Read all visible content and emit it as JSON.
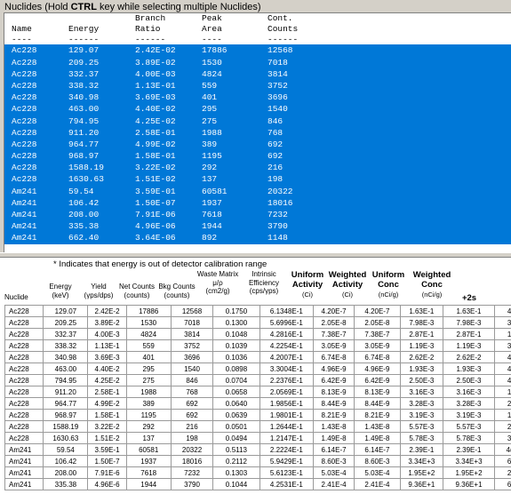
{
  "top": {
    "caption_prefix": "Nuclides  (Hold ",
    "caption_key": "CTRL",
    "caption_suffix": " key while selecting multiple Nuclides)",
    "header_line1": [
      "",
      "",
      "Branch",
      "Peak",
      "Cont."
    ],
    "header_line2": [
      "Name",
      "Energy",
      "Ratio",
      "Area",
      "Counts"
    ],
    "separator": [
      "----",
      "------",
      "------",
      "----",
      "------"
    ],
    "rows": [
      [
        "Ac228",
        "129.07",
        "2.42E-02",
        "17886",
        "12568"
      ],
      [
        "Ac228",
        "209.25",
        "3.89E-02",
        "1530",
        "7018"
      ],
      [
        "Ac228",
        "332.37",
        "4.00E-03",
        "4824",
        "3814"
      ],
      [
        "Ac228",
        "338.32",
        "1.13E-01",
        "559",
        "3752"
      ],
      [
        "Ac228",
        "340.98",
        "3.69E-03",
        "401",
        "3696"
      ],
      [
        "Ac228",
        "463.00",
        "4.40E-02",
        "295",
        "1540"
      ],
      [
        "Ac228",
        "794.95",
        "4.25E-02",
        "275",
        "846"
      ],
      [
        "Ac228",
        "911.20",
        "2.58E-01",
        "1988",
        "768"
      ],
      [
        "Ac228",
        "964.77",
        "4.99E-02",
        "389",
        "692"
      ],
      [
        "Ac228",
        "968.97",
        "1.58E-01",
        "1195",
        "692"
      ],
      [
        "Ac228",
        "1588.19",
        "3.22E-02",
        "292",
        "216"
      ],
      [
        "Ac228",
        "1630.63",
        "1.51E-02",
        "137",
        "198"
      ],
      [
        "Am241",
        "59.54",
        "3.59E-01",
        "60581",
        "20322"
      ],
      [
        "Am241",
        "106.42",
        "1.50E-07",
        "1937",
        "18016"
      ],
      [
        "Am241",
        "208.00",
        "7.91E-06",
        "7618",
        "7232"
      ],
      [
        "Am241",
        "335.38",
        "4.96E-06",
        "1944",
        "3790"
      ],
      [
        "Am241",
        "662.40",
        "3.64E-06",
        "892",
        "1148"
      ]
    ]
  },
  "bottom": {
    "note": "* Indicates that energy is out of detector calibration range",
    "headers": [
      {
        "label": "Nuclide",
        "unit": ""
      },
      {
        "label": "Energy",
        "unit": "(keV)"
      },
      {
        "label": "Yield",
        "unit": "(γps/dps)"
      },
      {
        "label": "Net Counts",
        "unit": "(counts)"
      },
      {
        "label": "Bkg Counts",
        "unit": "(counts)"
      },
      {
        "label": "Waste Matrix",
        "unit": "μ/ρ",
        "unit2": "(cm2/g)"
      },
      {
        "label": "Intrinsic",
        "unit": "Efficiency",
        "unit2": "(cps/γps)"
      },
      {
        "label": "Uniform",
        "label2": "Activity",
        "unit": "(Ci)"
      },
      {
        "label": "Weighted",
        "label2": "Activity",
        "unit": "(Ci)"
      },
      {
        "label": "Uniform",
        "label2": "Conc",
        "unit": "(nCi/g)"
      },
      {
        "label": "Weighted",
        "label2": "Conc",
        "unit": "(nCi/g)"
      },
      {
        "label": "+2s",
        "unit": ""
      }
    ],
    "rows": [
      [
        "Ac228",
        "129.07",
        "2.42E-2",
        "17886",
        "12568",
        "0.1750",
        "6.1348E-1",
        "4.20E-7",
        "4.20E-7",
        "1.63E-1",
        "1.63E-1",
        "4"
      ],
      [
        "Ac228",
        "209.25",
        "3.89E-2",
        "1530",
        "7018",
        "0.1300",
        "5.6996E-1",
        "2.05E-8",
        "2.05E-8",
        "7.98E-3",
        "7.98E-3",
        "3"
      ],
      [
        "Ac228",
        "332.37",
        "4.00E-3",
        "4824",
        "3814",
        "0.1048",
        "4.2816E-1",
        "7.38E-7",
        "7.38E-7",
        "2.87E-1",
        "2.87E-1",
        "1"
      ],
      [
        "Ac228",
        "338.32",
        "1.13E-1",
        "559",
        "3752",
        "0.1039",
        "4.2254E-1",
        "3.05E-9",
        "3.05E-9",
        "1.19E-3",
        "1.19E-3",
        "3"
      ],
      [
        "Ac228",
        "340.98",
        "3.69E-3",
        "401",
        "3696",
        "0.1036",
        "4.2007E-1",
        "6.74E-8",
        "6.74E-8",
        "2.62E-2",
        "2.62E-2",
        "4"
      ],
      [
        "Ac228",
        "463.00",
        "4.40E-2",
        "295",
        "1540",
        "0.0898",
        "3.3004E-1",
        "4.96E-9",
        "4.96E-9",
        "1.93E-3",
        "1.93E-3",
        "4"
      ],
      [
        "Ac228",
        "794.95",
        "4.25E-2",
        "275",
        "846",
        "0.0704",
        "2.2376E-1",
        "6.42E-9",
        "6.42E-9",
        "2.50E-3",
        "2.50E-3",
        "4"
      ],
      [
        "Ac228",
        "911.20",
        "2.58E-1",
        "1988",
        "768",
        "0.0658",
        "2.0569E-1",
        "8.13E-9",
        "8.13E-9",
        "3.16E-3",
        "3.16E-3",
        "1"
      ],
      [
        "Ac228",
        "964.77",
        "4.99E-2",
        "389",
        "692",
        "0.0640",
        "1.9856E-1",
        "8.44E-9",
        "8.44E-9",
        "3.28E-3",
        "3.28E-3",
        "2"
      ],
      [
        "Ac228",
        "968.97",
        "1.58E-1",
        "1195",
        "692",
        "0.0639",
        "1.9801E-1",
        "8.21E-9",
        "8.21E-9",
        "3.19E-3",
        "3.19E-3",
        "1"
      ],
      [
        "Ac228",
        "1588.19",
        "3.22E-2",
        "292",
        "216",
        "0.0501",
        "1.2644E-1",
        "1.43E-8",
        "1.43E-8",
        "5.57E-3",
        "5.57E-3",
        "2"
      ],
      [
        "Ac228",
        "1630.63",
        "1.51E-2",
        "137",
        "198",
        "0.0494",
        "1.2147E-1",
        "1.49E-8",
        "1.49E-8",
        "5.78E-3",
        "5.78E-3",
        "3"
      ],
      [
        "Am241",
        "59.54",
        "3.59E-1",
        "60581",
        "20322",
        "0.5113",
        "2.2224E-1",
        "6.14E-7",
        "6.14E-7",
        "2.39E-1",
        "2.39E-1",
        "4("
      ],
      [
        "Am241",
        "106.42",
        "1.50E-7",
        "1937",
        "18016",
        "0.2112",
        "5.9429E-1",
        "8.60E-3",
        "8.60E-3",
        "3.34E+3",
        "3.34E+3",
        "6"
      ],
      [
        "Am241",
        "208.00",
        "7.91E-6",
        "7618",
        "7232",
        "0.1303",
        "5.6123E-1",
        "5.03E-4",
        "5.03E-4",
        "1.95E+2",
        "1.95E+2",
        "2"
      ],
      [
        "Am241",
        "335.38",
        "4.96E-6",
        "1944",
        "3790",
        "0.1044",
        "4.2531E-1",
        "2.41E-4",
        "2.41E-4",
        "9.36E+1",
        "9.36E+1",
        "6"
      ]
    ]
  }
}
